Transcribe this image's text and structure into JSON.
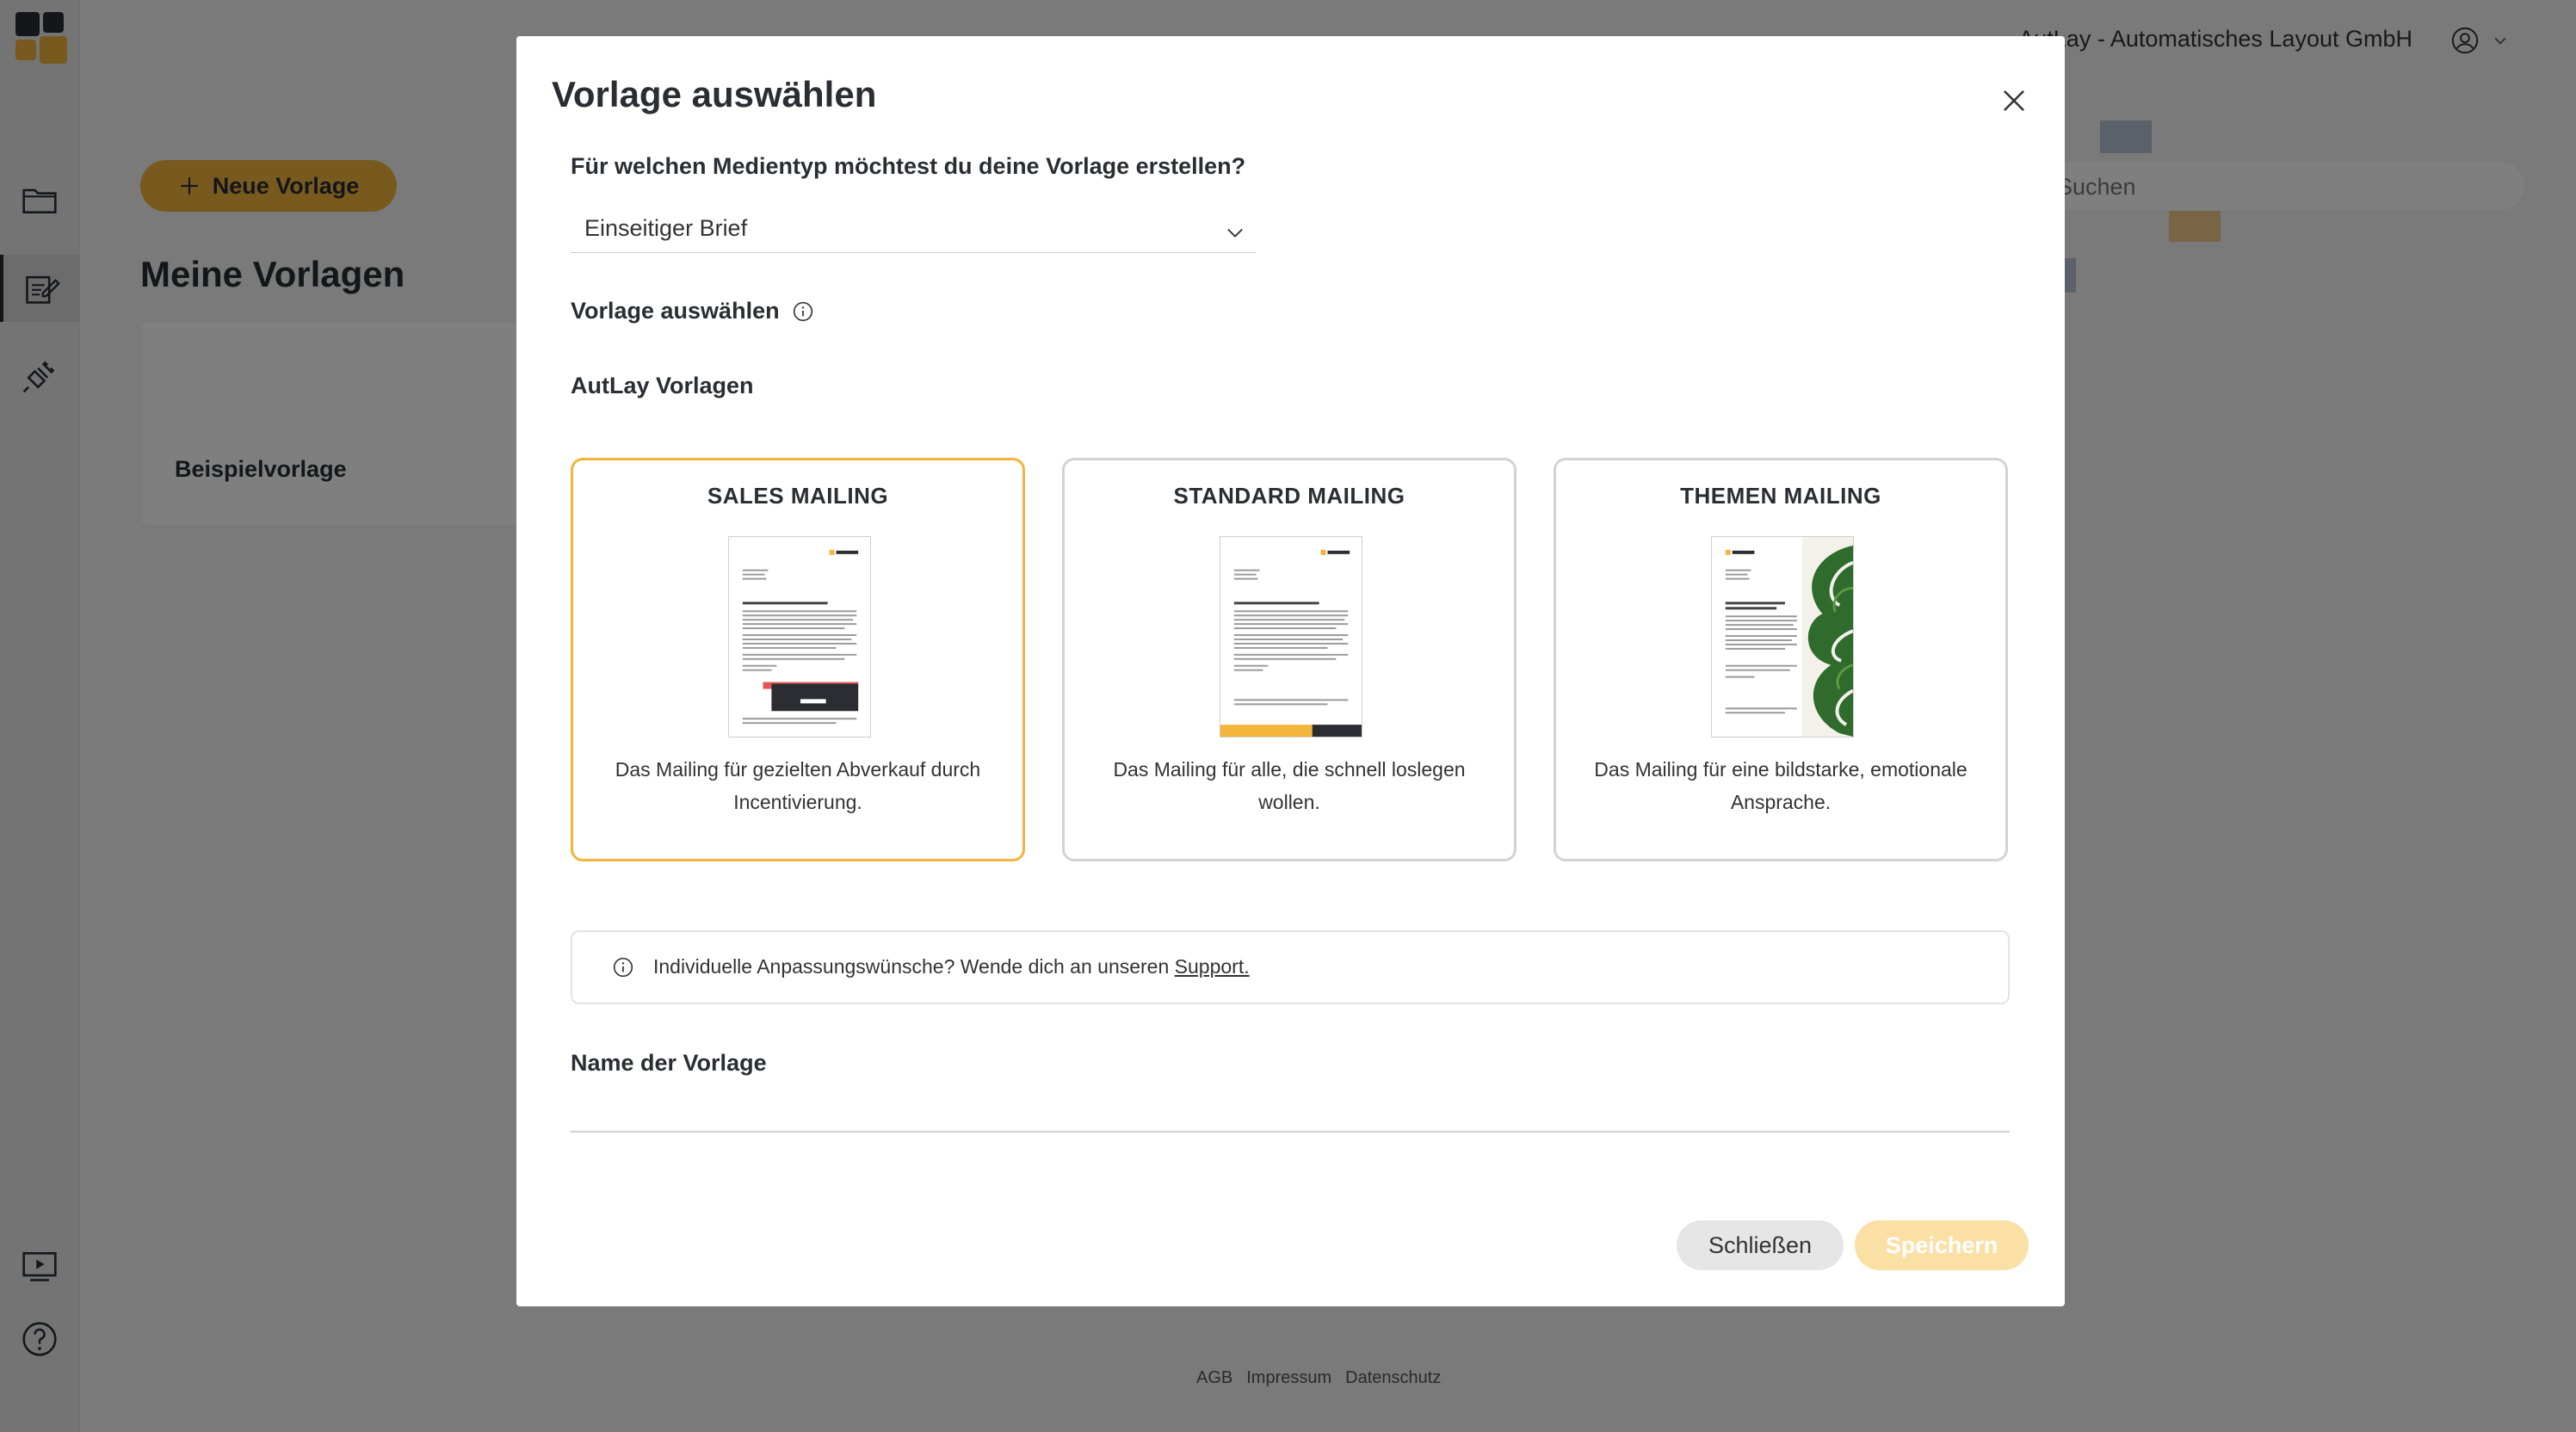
{
  "app": {
    "company": "AutLay - Automatisches Layout GmbH",
    "new_template_button": "Neue Vorlage",
    "page_title": "Meine Vorlagen",
    "sample_template": "Beispielvorlage",
    "search_placeholder": "Suchen",
    "footer": {
      "agb": "AGB",
      "impressum": "Impressum",
      "datenschutz": "Datenschutz"
    }
  },
  "modal": {
    "title": "Vorlage auswählen",
    "media_question": "Für welchen Medientyp möchtest du deine Vorlage erstellen?",
    "media_type_value": "Einseitiger Brief",
    "select_template_label": "Vorlage auswählen",
    "autlay_templates_label": "AutLay Vorlagen",
    "templates": [
      {
        "name": "SALES MAILING",
        "description": "Das Mailing für gezielten Abverkauf durch Incentivierung.",
        "selected": true
      },
      {
        "name": "STANDARD MAILING",
        "description": "Das Mailing für alle, die schnell loslegen wollen.",
        "selected": false
      },
      {
        "name": "THEMEN MAILING",
        "description": "Das Mailing für eine bildstarke, emotionale Ansprache.",
        "selected": false
      }
    ],
    "info_text": "Individuelle Anpassungswünsche? Wende dich an unseren",
    "info_link": "Support.",
    "name_label": "Name der Vorlage",
    "name_value": "",
    "close_button": "Schließen",
    "save_button": "Speichern"
  },
  "colors": {
    "accent": "#f3b43c",
    "dark": "#2b2d33",
    "save_disabled": "#fbe0a6",
    "close_bg": "#e6e6e6"
  }
}
